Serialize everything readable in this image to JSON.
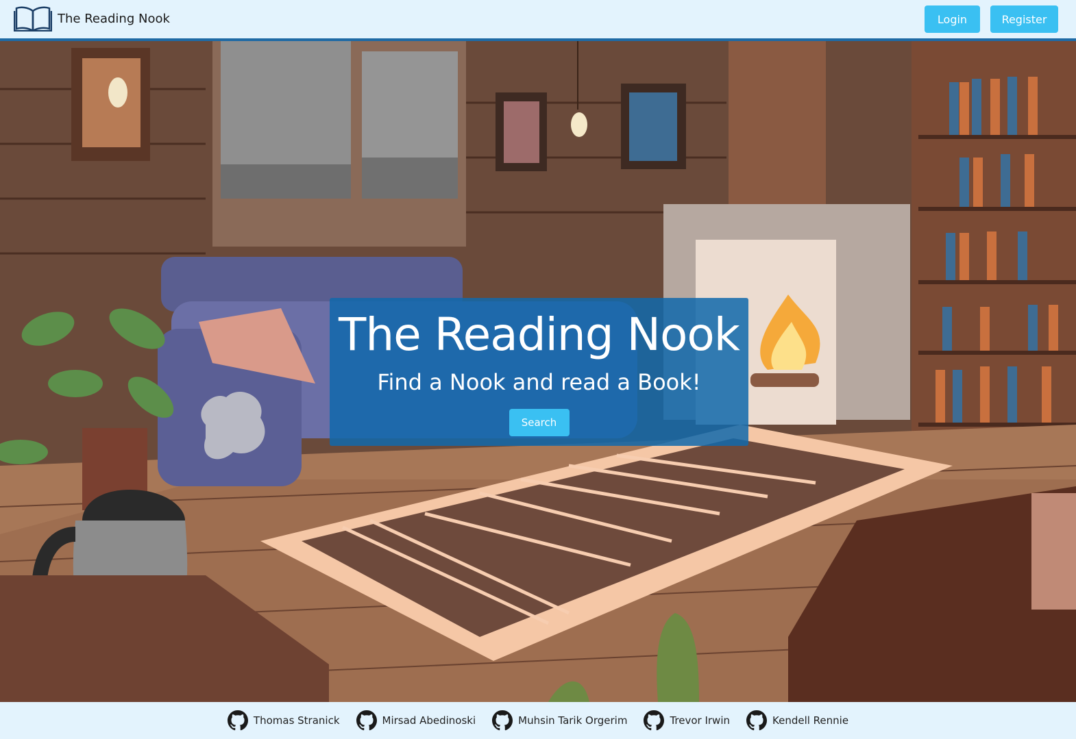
{
  "header": {
    "brand_title": "The Reading Nook",
    "brand_icon": "open-book-icon",
    "login_label": "Login",
    "register_label": "Register"
  },
  "hero": {
    "title": "The Reading Nook",
    "subtitle": "Find a Nook and read a Book!",
    "search_label": "Search"
  },
  "footer": {
    "authors": [
      {
        "name": "Thomas Stranick",
        "icon": "github-icon"
      },
      {
        "name": "Mirsad Abedinoski",
        "icon": "github-icon"
      },
      {
        "name": "Muhsin Tarik Orgerim",
        "icon": "github-icon"
      },
      {
        "name": "Trevor Irwin",
        "icon": "github-icon"
      },
      {
        "name": "Kendell Rennie",
        "icon": "github-icon"
      }
    ]
  },
  "colors": {
    "navbar_bg": "#e3f3fd",
    "navbar_border": "#1f6aa5",
    "button": "#3ac0f2",
    "hero_card": "#1168ac"
  }
}
